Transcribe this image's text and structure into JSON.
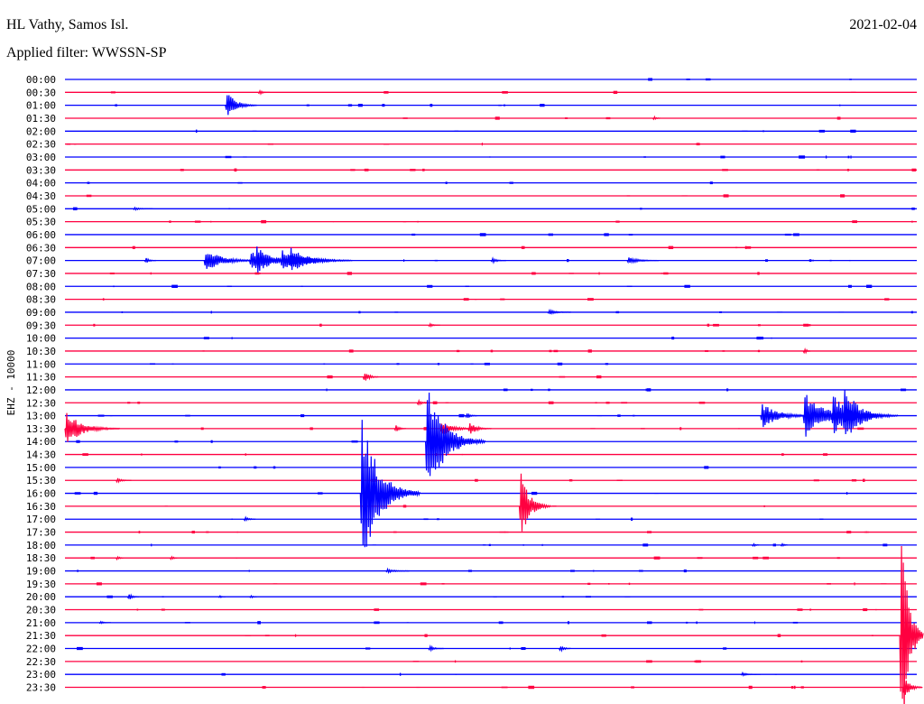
{
  "header": {
    "station": "HL Vathy, Samos Isl.",
    "filter": "Applied filter: WWSSN-SP",
    "date": "2021-02-04"
  },
  "chart_data": {
    "type": "line",
    "title": "HL Vathy, Samos Isl.",
    "ylabel": "EHZ - 10000",
    "xlabel": "",
    "minutes_per_row": 30,
    "colors": [
      "#0000ff",
      "#ff0040"
    ],
    "rows": [
      "00:00",
      "00:30",
      "01:00",
      "01:30",
      "02:00",
      "02:30",
      "03:00",
      "03:30",
      "04:00",
      "04:30",
      "05:00",
      "05:30",
      "06:00",
      "06:30",
      "07:00",
      "07:30",
      "08:00",
      "08:30",
      "09:00",
      "09:30",
      "10:00",
      "10:30",
      "11:00",
      "11:30",
      "12:00",
      "12:30",
      "13:00",
      "13:30",
      "14:00",
      "14:30",
      "15:00",
      "15:30",
      "16:00",
      "16:30",
      "17:00",
      "17:30",
      "18:00",
      "18:30",
      "19:00",
      "19:30",
      "20:00",
      "20:30",
      "21:00",
      "21:30",
      "22:00",
      "22:30",
      "23:00",
      "23:30"
    ],
    "events": [
      {
        "row": 1,
        "minute": 6.8,
        "amp": 0.3,
        "dur": 0.3
      },
      {
        "row": 2,
        "minute": 5.65,
        "amp": 1.4,
        "dur": 0.8
      },
      {
        "row": 3,
        "minute": 20.7,
        "amp": 0.3,
        "dur": 0.2
      },
      {
        "row": 10,
        "minute": 2.4,
        "amp": 0.15,
        "dur": 0.5
      },
      {
        "row": 14,
        "minute": 2.8,
        "amp": 0.4,
        "dur": 0.3
      },
      {
        "row": 14,
        "minute": 4.9,
        "amp": 1.0,
        "dur": 1.5
      },
      {
        "row": 14,
        "minute": 6.5,
        "amp": 0.9,
        "dur": 1.5
      },
      {
        "row": 14,
        "minute": 6.7,
        "amp": 1.3,
        "dur": 1.2
      },
      {
        "row": 14,
        "minute": 7.9,
        "amp": 1.2,
        "dur": 1.6
      },
      {
        "row": 14,
        "minute": 7.6,
        "amp": 1.3,
        "dur": 0.8
      },
      {
        "row": 14,
        "minute": 7.8,
        "amp": 0.6,
        "dur": 1.6
      },
      {
        "row": 14,
        "minute": 15.0,
        "amp": 0.3,
        "dur": 0.4
      },
      {
        "row": 14,
        "minute": 19.8,
        "amp": 0.35,
        "dur": 0.8
      },
      {
        "row": 18,
        "minute": 17.0,
        "amp": 0.25,
        "dur": 0.6
      },
      {
        "row": 19,
        "minute": 12.8,
        "amp": 0.25,
        "dur": 0.3
      },
      {
        "row": 21,
        "minute": 26.0,
        "amp": 0.55,
        "dur": 0.2
      },
      {
        "row": 23,
        "minute": 10.5,
        "amp": 0.7,
        "dur": 0.4
      },
      {
        "row": 25,
        "minute": 12.4,
        "amp": 0.4,
        "dur": 0.3
      },
      {
        "row": 26,
        "minute": 24.5,
        "amp": 1.1,
        "dur": 1.5
      },
      {
        "row": 26,
        "minute": 26.0,
        "amp": 2.0,
        "dur": 1.8
      },
      {
        "row": 26,
        "minute": 27.0,
        "amp": 1.9,
        "dur": 1.4
      },
      {
        "row": 26,
        "minute": 27.4,
        "amp": 2.5,
        "dur": 1.4
      },
      {
        "row": 26,
        "minute": 14.1,
        "amp": 0.4,
        "dur": 0.3
      },
      {
        "row": 27,
        "minute": 0.0,
        "amp": 1.5,
        "dur": 1.4
      },
      {
        "row": 27,
        "minute": 11.6,
        "amp": 0.5,
        "dur": 0.3
      },
      {
        "row": 27,
        "minute": 13.2,
        "amp": 0.7,
        "dur": 1.0
      },
      {
        "row": 27,
        "minute": 14.2,
        "amp": 0.7,
        "dur": 0.6
      },
      {
        "row": 28,
        "minute": 12.7,
        "amp": 5.5,
        "dur": 1.5
      },
      {
        "row": 31,
        "minute": 1.8,
        "amp": 0.3,
        "dur": 0.4
      },
      {
        "row": 32,
        "minute": 10.4,
        "amp": 7.0,
        "dur": 1.5
      },
      {
        "row": 33,
        "minute": 16.0,
        "amp": 3.2,
        "dur": 0.8
      },
      {
        "row": 34,
        "minute": 6.3,
        "amp": 0.3,
        "dur": 0.3
      },
      {
        "row": 36,
        "minute": 24.2,
        "amp": 0.3,
        "dur": 0.2
      },
      {
        "row": 36,
        "minute": 25.2,
        "amp": 0.3,
        "dur": 0.2
      },
      {
        "row": 37,
        "minute": 1.8,
        "amp": 0.35,
        "dur": 0.2
      },
      {
        "row": 37,
        "minute": 3.7,
        "amp": 0.35,
        "dur": 0.2
      },
      {
        "row": 38,
        "minute": 11.3,
        "amp": 0.2,
        "dur": 0.6
      },
      {
        "row": 40,
        "minute": 2.2,
        "amp": 0.45,
        "dur": 0.3
      },
      {
        "row": 40,
        "minute": 5.4,
        "amp": 0.2,
        "dur": 0.2
      },
      {
        "row": 40,
        "minute": 6.5,
        "amp": 0.3,
        "dur": 0.2
      },
      {
        "row": 42,
        "minute": 1.2,
        "amp": 0.2,
        "dur": 0.3
      },
      {
        "row": 43,
        "minute": 29.4,
        "amp": 14.0,
        "dur": 0.6
      },
      {
        "row": 44,
        "minute": 12.8,
        "amp": 0.3,
        "dur": 0.4
      },
      {
        "row": 44,
        "minute": 17.4,
        "amp": 0.5,
        "dur": 0.3
      },
      {
        "row": 46,
        "minute": 23.8,
        "amp": 0.2,
        "dur": 0.5
      },
      {
        "row": 47,
        "minute": 29.5,
        "amp": 1.5,
        "dur": 0.5
      }
    ]
  }
}
